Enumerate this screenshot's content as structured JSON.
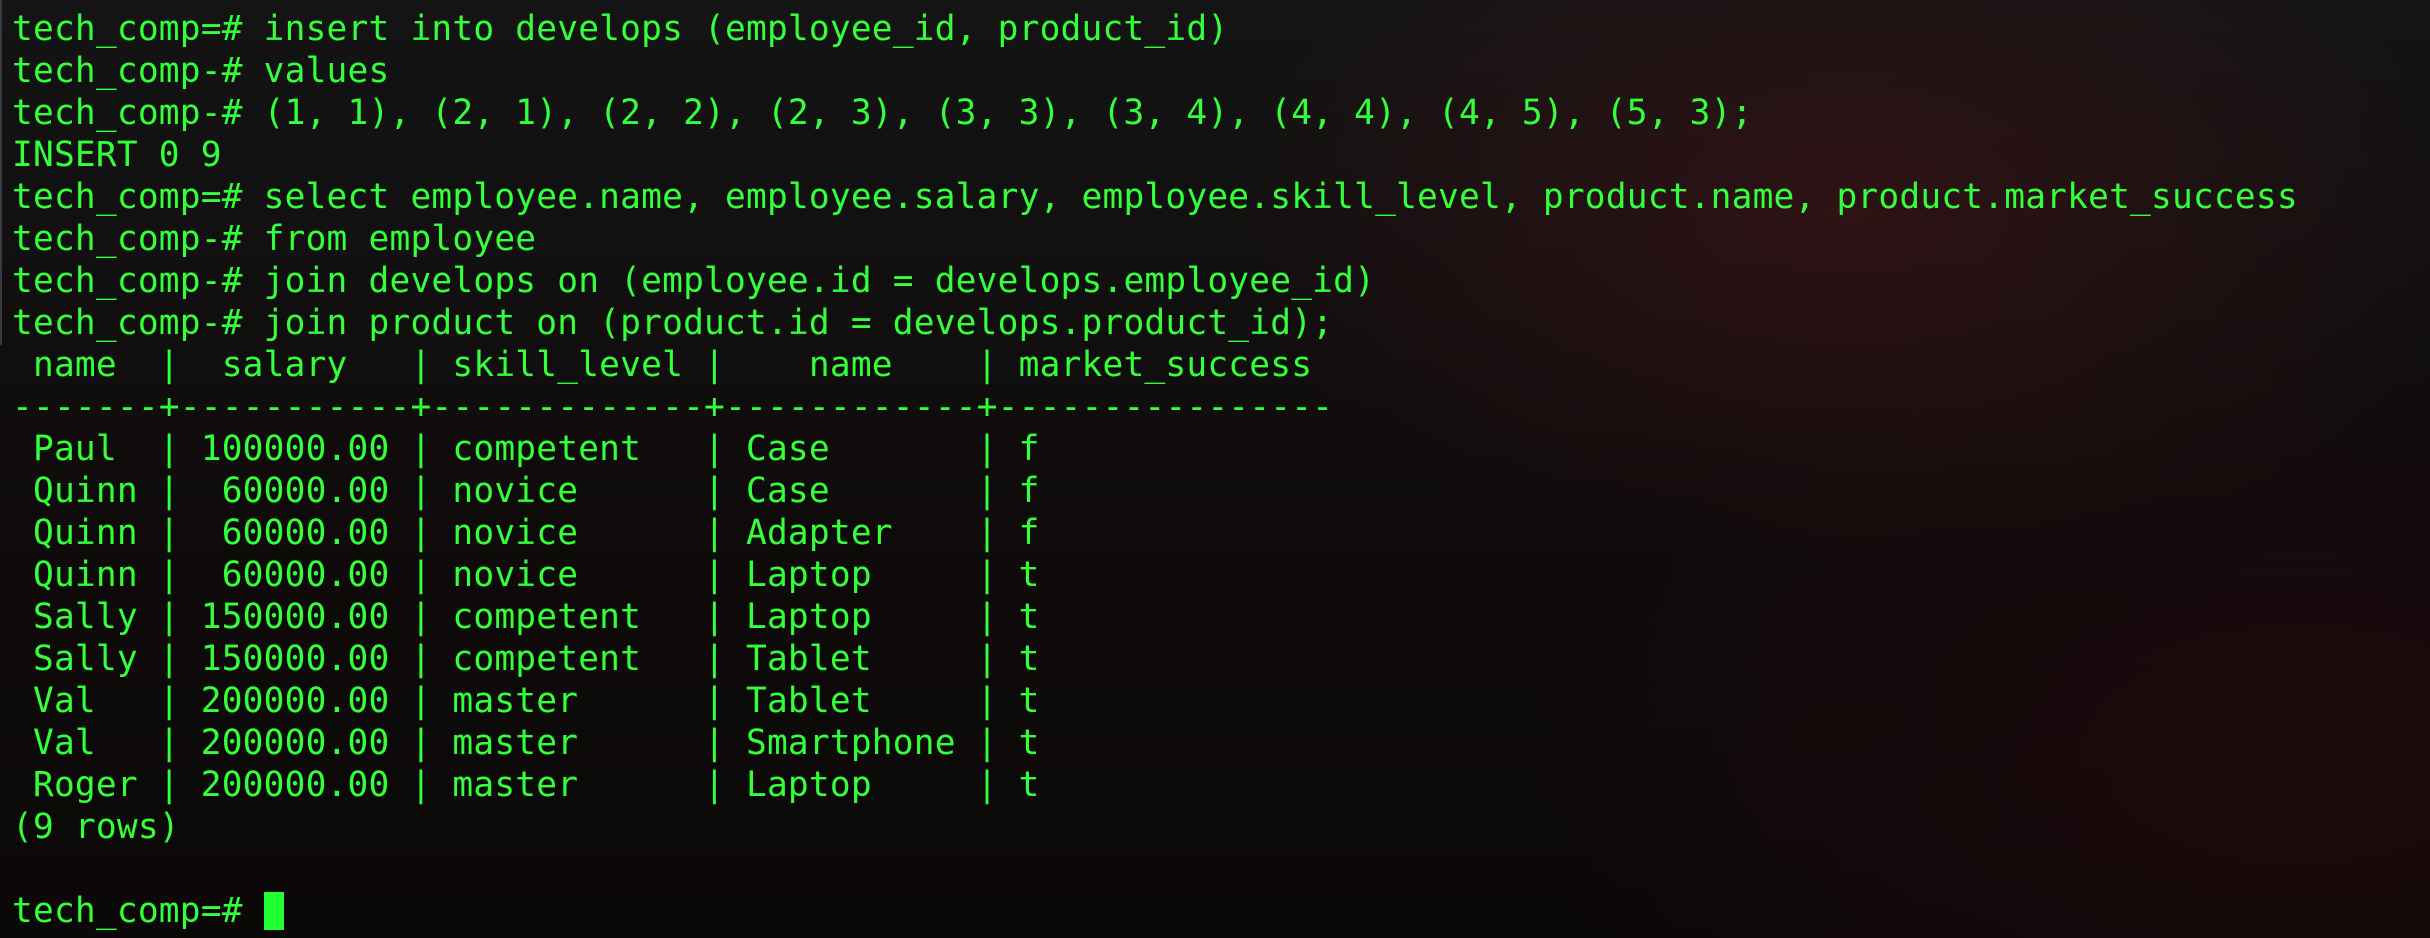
{
  "terminal": {
    "prompt": "tech_comp=#",
    "lines": [
      "tech_comp=# insert into develops (employee_id, product_id)",
      "tech_comp-# values",
      "tech_comp-# (1, 1), (2, 1), (2, 2), (2, 3), (3, 3), (3, 4), (4, 4), (4, 5), (5, 3);",
      "INSERT 0 9",
      "tech_comp=# select employee.name, employee.salary, employee.skill_level, product.name, product.market_success",
      "tech_comp-# from employee",
      "tech_comp-# join develops on (employee.id = develops.employee_id)",
      "tech_comp-# join product on (product.id = develops.product_id);",
      " name  |  salary   | skill_level |    name    | market_success",
      "-------+-----------+-------------+------------+----------------",
      " Paul  | 100000.00 | competent   | Case       | f",
      " Quinn |  60000.00 | novice      | Case       | f",
      " Quinn |  60000.00 | novice      | Adapter    | f",
      " Quinn |  60000.00 | novice      | Laptop     | t",
      " Sally | 150000.00 | competent   | Laptop     | t",
      " Sally | 150000.00 | competent   | Tablet     | t",
      " Val   | 200000.00 | master      | Tablet     | t",
      " Val   | 200000.00 | master      | Smartphone | t",
      " Roger | 200000.00 | master      | Laptop     | t",
      "(9 rows)",
      ""
    ]
  },
  "colors": {
    "text": "#33ff3a",
    "cursor": "#22ff33",
    "background": "#0b0b0b"
  }
}
